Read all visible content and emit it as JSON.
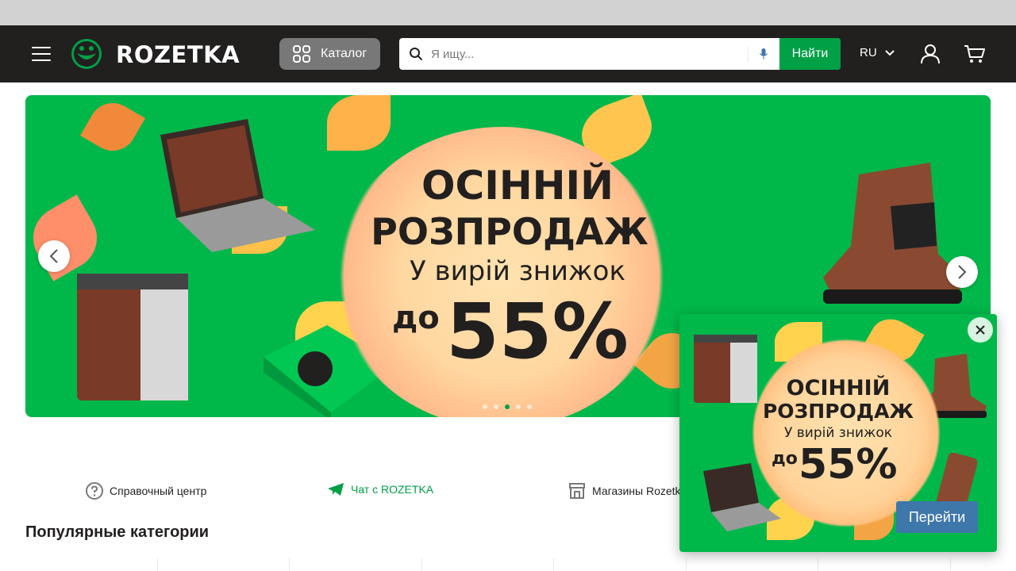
{
  "colors": {
    "header_bg": "#221f1f",
    "accent_green": "#00a046",
    "catalog_bg": "#797878",
    "banner_green": "#00b84a",
    "popup_button": "#3e77aa"
  },
  "header": {
    "logo_text": "ROZETKA",
    "catalog_label": "Каталог",
    "search_placeholder": "Я ищу...",
    "search_button": "Найти",
    "language": "RU",
    "icons": [
      "menu-icon",
      "rozetka-logo-icon",
      "grid-icon",
      "search-icon",
      "mic-icon",
      "chevron-down-icon",
      "user-icon",
      "cart-icon"
    ]
  },
  "banner": {
    "line1": "ОСІННІЙ",
    "line2": "РОЗПРОДАЖ",
    "line3": "У вирій знижок",
    "prefix": "до",
    "discount": "55%",
    "dots_count": 5,
    "active_dot": 3
  },
  "links": [
    {
      "label": "Справочный центр",
      "icon": "help-circle-icon"
    },
    {
      "label": "Чат с ROZETKA",
      "icon": "telegram-icon"
    },
    {
      "label": "Магазины Rozetka",
      "icon": "store-icon"
    }
  ],
  "section_title": "Популярные категории",
  "popup": {
    "line1": "ОСІННІЙ",
    "line2": "РОЗПРОДАЖ",
    "line3": "У вирій знижок",
    "prefix": "до",
    "discount": "55%",
    "button": "Перейти"
  }
}
